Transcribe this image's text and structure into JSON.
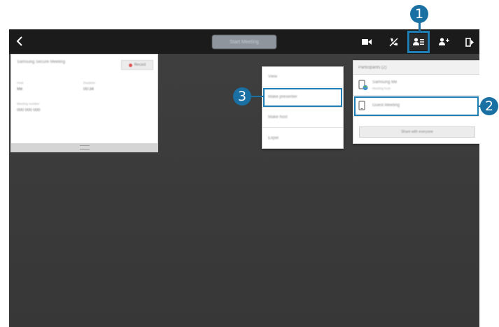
{
  "toolbar": {
    "title": "Start Meeting",
    "icons": [
      "back-icon",
      "video-icon",
      "mute-icon",
      "participants-icon",
      "add-participant-icon",
      "exit-icon"
    ]
  },
  "meeting_card": {
    "title": "Samsung Secure Meeting",
    "record_label": "Record",
    "fields": [
      {
        "label": "Host",
        "value": "Me"
      },
      {
        "label": "Duration",
        "value": "00:34"
      },
      {
        "label": "Meeting number",
        "value": "000 000 000"
      }
    ]
  },
  "context_menu": {
    "items": [
      "View",
      "Make presenter",
      "Make host",
      "Expel"
    ]
  },
  "participants_panel": {
    "header": "Participants (2)",
    "participants": [
      {
        "name": "Samsung Me",
        "subtitle": "Meeting host"
      },
      {
        "name": "Guest Meeting",
        "subtitle": ""
      }
    ],
    "share_button": "Share with everyone"
  },
  "callouts": [
    "1",
    "2",
    "3"
  ],
  "colors": {
    "accent": "#1f7fb5",
    "callout": "#1a6fa3",
    "toolbar_bg": "#1b1b1b",
    "screen_bg": "#3c3c3c"
  }
}
